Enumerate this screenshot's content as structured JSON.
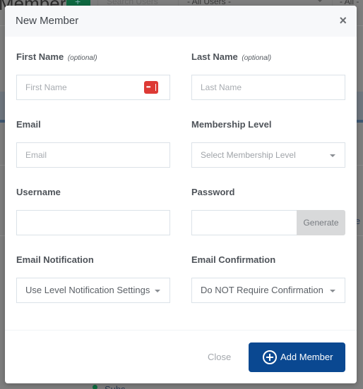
{
  "background": {
    "page_title": "Members",
    "search_placeholder": "Search Users",
    "users_filter": "- All Users -",
    "all_filter": "- All -",
    "partial_link": "e (",
    "status_text": "Subs"
  },
  "modal": {
    "title": "New Member",
    "close_icon": "×",
    "fields": {
      "first_name": {
        "label": "First Name",
        "optional": "(optional)",
        "placeholder": "First Name",
        "value": ""
      },
      "last_name": {
        "label": "Last Name",
        "optional": "(optional)",
        "placeholder": "Last Name",
        "value": ""
      },
      "email": {
        "label": "Email",
        "placeholder": "Email",
        "value": ""
      },
      "membership_level": {
        "label": "Membership Level",
        "selected": "Select Membership Level"
      },
      "username": {
        "label": "Username",
        "value": ""
      },
      "password": {
        "label": "Password",
        "value": "",
        "generate_label": "Generate"
      },
      "email_notification": {
        "label": "Email Notification",
        "selected": "Use Level Notification Settings"
      },
      "email_confirmation": {
        "label": "Email Confirmation",
        "selected": "Do NOT Require Confirmation"
      }
    },
    "footer": {
      "close_label": "Close",
      "add_label": "Add Member"
    }
  },
  "colors": {
    "primary": "#0a4891",
    "password_manager_icon": "#dd3a35",
    "add_bg_button": "#0e6840"
  }
}
